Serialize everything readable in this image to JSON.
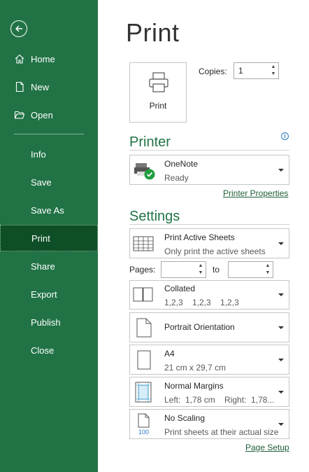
{
  "sidebar": {
    "items": [
      {
        "label": "Home"
      },
      {
        "label": "New"
      },
      {
        "label": "Open"
      },
      {
        "label": "Info"
      },
      {
        "label": "Save"
      },
      {
        "label": "Save As"
      },
      {
        "label": "Print"
      },
      {
        "label": "Share"
      },
      {
        "label": "Export"
      },
      {
        "label": "Publish"
      },
      {
        "label": "Close"
      }
    ]
  },
  "main": {
    "title": "Print",
    "print_button_label": "Print",
    "copies_label": "Copies:",
    "copies_value": "1",
    "printer": {
      "heading": "Printer",
      "name": "OneNote",
      "status": "Ready",
      "properties_link": "Printer Properties"
    },
    "settings": {
      "heading": "Settings",
      "sheets": {
        "title": "Print Active Sheets",
        "sub": "Only print the active sheets"
      },
      "pages_label": "Pages:",
      "to_label": "to",
      "pages_from": "",
      "pages_to": "",
      "collate": {
        "title": "Collated",
        "sub": "1,2,3    1,2,3    1,2,3"
      },
      "orientation": {
        "title": "Portrait Orientation"
      },
      "paper": {
        "title": "A4",
        "sub": "21 cm x 29,7 cm"
      },
      "margins": {
        "title": "Normal Margins",
        "sub": "Left:  1,78 cm    Right:  1,78..."
      },
      "scaling": {
        "title": "No Scaling",
        "sub": "Print sheets at their actual size",
        "icon_text": "100"
      },
      "page_setup_link": "Page Setup"
    }
  },
  "colors": {
    "accent": "#217346",
    "sidebar_active": "#0e4f27",
    "link": "#1e5e36"
  }
}
